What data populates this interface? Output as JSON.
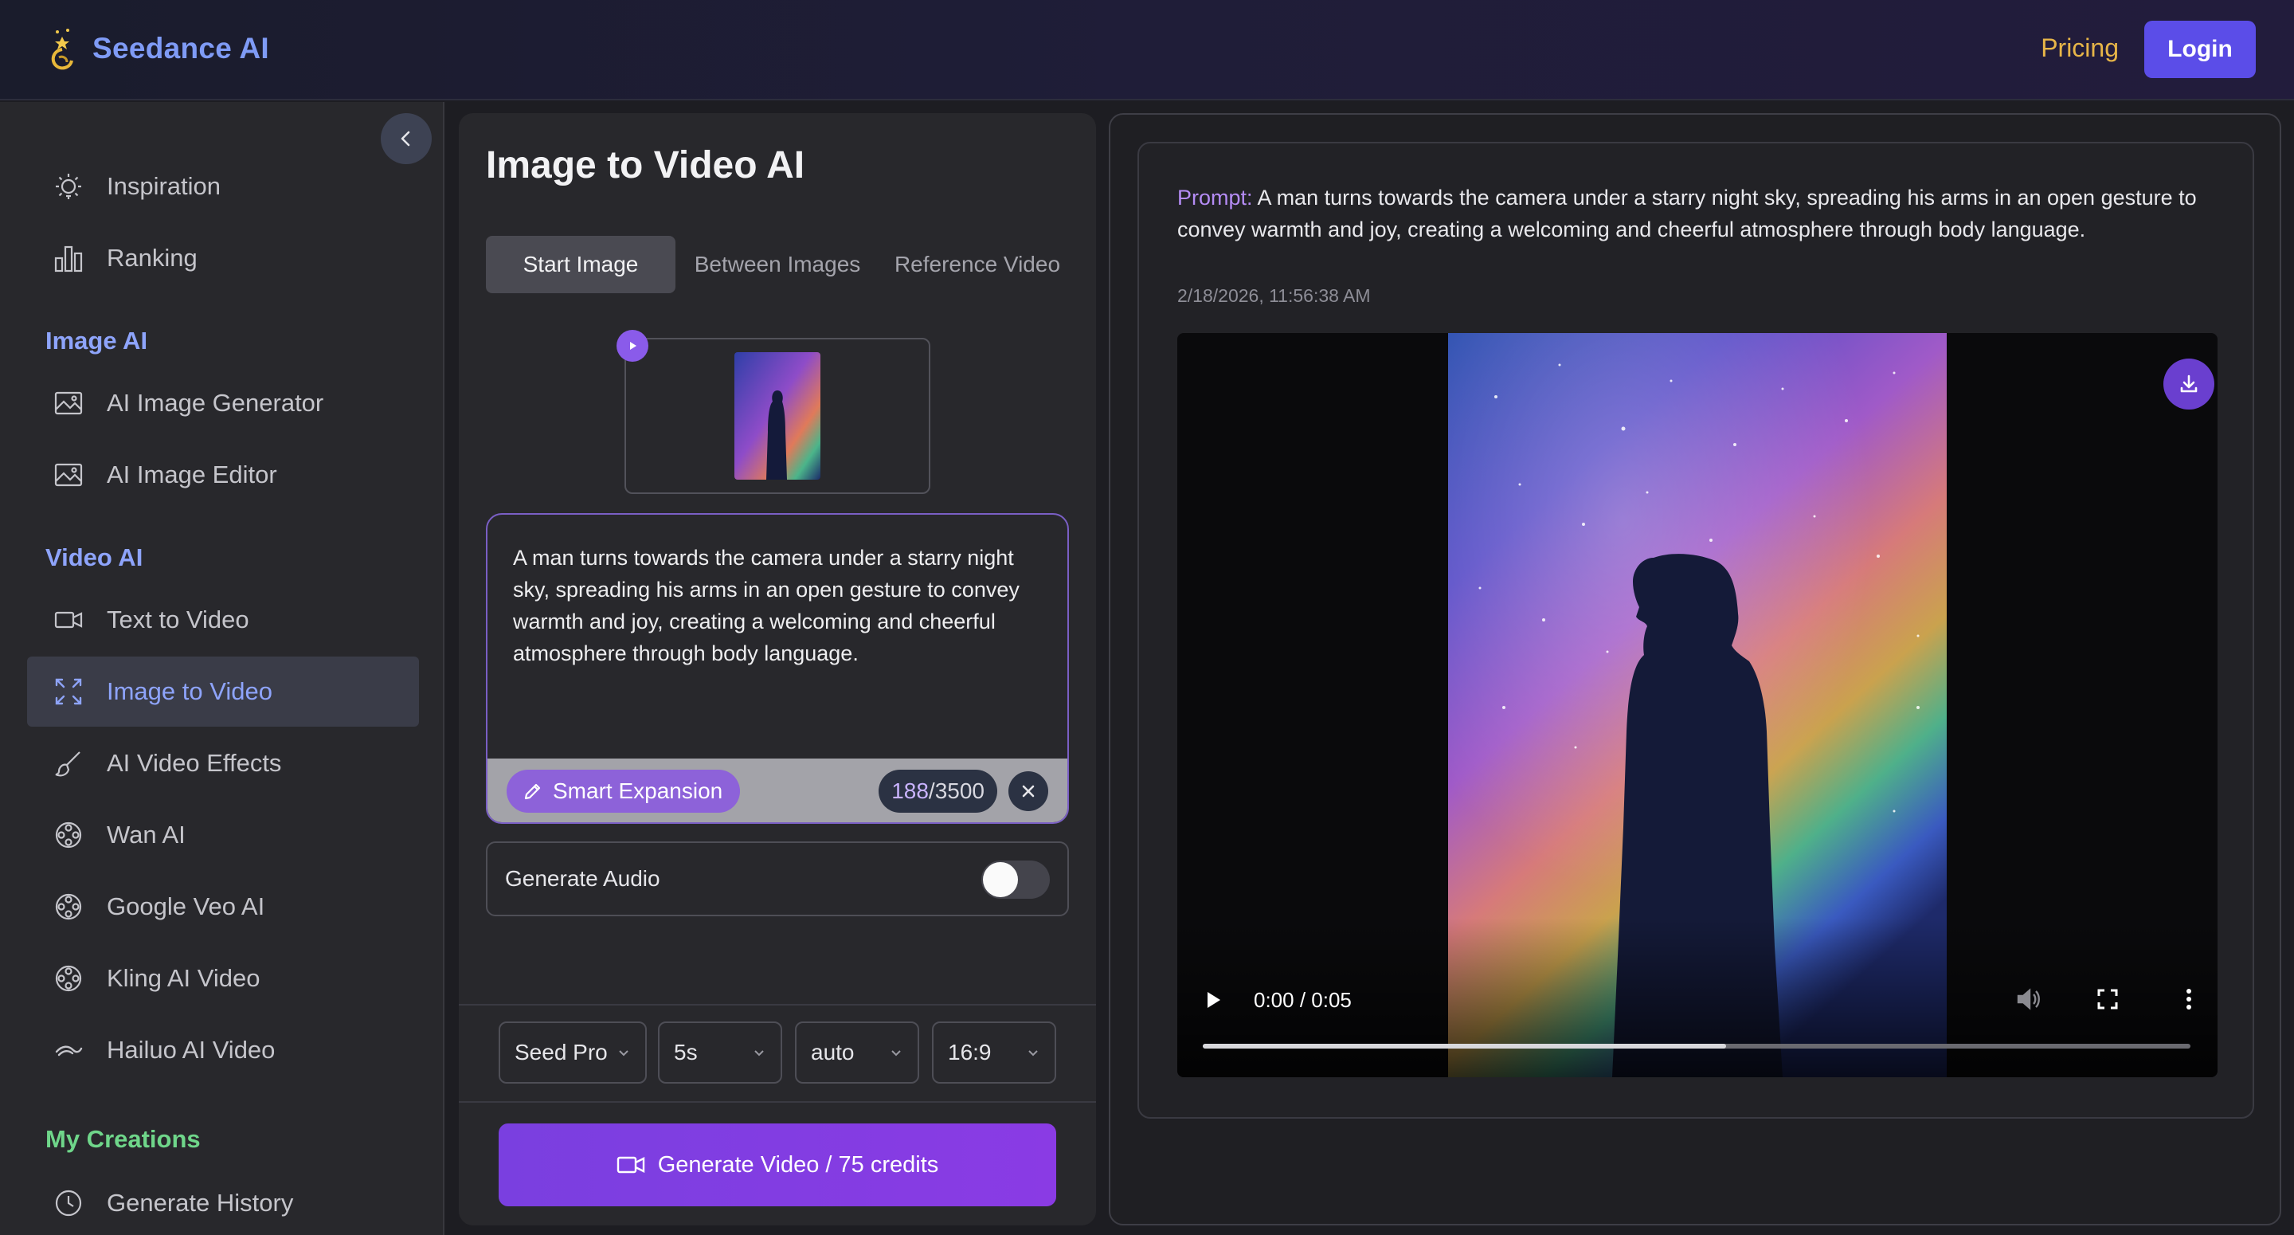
{
  "header": {
    "brand": "Seedance AI",
    "pricing": "Pricing",
    "login": "Login"
  },
  "sidebar": {
    "top_items": [
      {
        "label": "Inspiration",
        "icon": "lightbulb-icon"
      },
      {
        "label": "Ranking",
        "icon": "bar-chart-icon"
      }
    ],
    "sections": [
      {
        "title": "Image AI",
        "color": "#8ea4fb"
      },
      {
        "title": "Video AI",
        "color": "#8ea4fb"
      },
      {
        "title": "My Creations",
        "color": "#6fd68a"
      }
    ],
    "image_items": [
      {
        "label": "AI Image Generator",
        "icon": "image-icon"
      },
      {
        "label": "AI Image Editor",
        "icon": "image-icon"
      }
    ],
    "video_items": [
      {
        "label": "Text to Video",
        "icon": "video-camera-icon"
      },
      {
        "label": "Image to Video",
        "icon": "expand-icon",
        "active": true
      },
      {
        "label": "AI Video Effects",
        "icon": "brush-icon"
      },
      {
        "label": "Wan AI",
        "icon": "film-reel-icon"
      },
      {
        "label": "Google Veo AI",
        "icon": "film-reel-icon"
      },
      {
        "label": "Kling AI Video",
        "icon": "film-reel-icon"
      },
      {
        "label": "Hailuo AI Video",
        "icon": "hailuo-logo-icon"
      }
    ],
    "creation_items": [
      {
        "label": "Generate History",
        "icon": "clock-icon"
      }
    ]
  },
  "panel": {
    "title": "Image to Video AI",
    "tabs": [
      "Start Image",
      "Between Images",
      "Reference Video"
    ],
    "active_tab": "Start Image",
    "prompt": "A man turns towards the camera under a starry night sky, spreading his arms in an open gesture to convey warmth and joy, creating a welcoming and cheerful atmosphere through body language.",
    "smart_expansion": "Smart Expansion",
    "char_count": "188",
    "char_limit": "/3500",
    "generate_audio": "Generate Audio",
    "generate_audio_on": false,
    "model": "Seed Pro",
    "duration": "5s",
    "resolution": "auto",
    "aspect_ratio": "16:9",
    "generate_button": "Generate Video / 75 credits"
  },
  "result": {
    "prompt_label": "Prompt:",
    "prompt": "A man turns towards the camera under a starry night sky, spreading his arms in an open gesture to convey warmth and joy, creating a welcoming and cheerful atmosphere through body language.",
    "timestamp": "2/18/2026, 11:56:38 AM",
    "video_time": "0:00 / 0:05",
    "buffered_fraction": 0.53
  },
  "colors": {
    "accent": "#5b4de8",
    "generate": "#7a3fe0",
    "brand": "#7f9bf6",
    "pricing": "#e7b548"
  }
}
